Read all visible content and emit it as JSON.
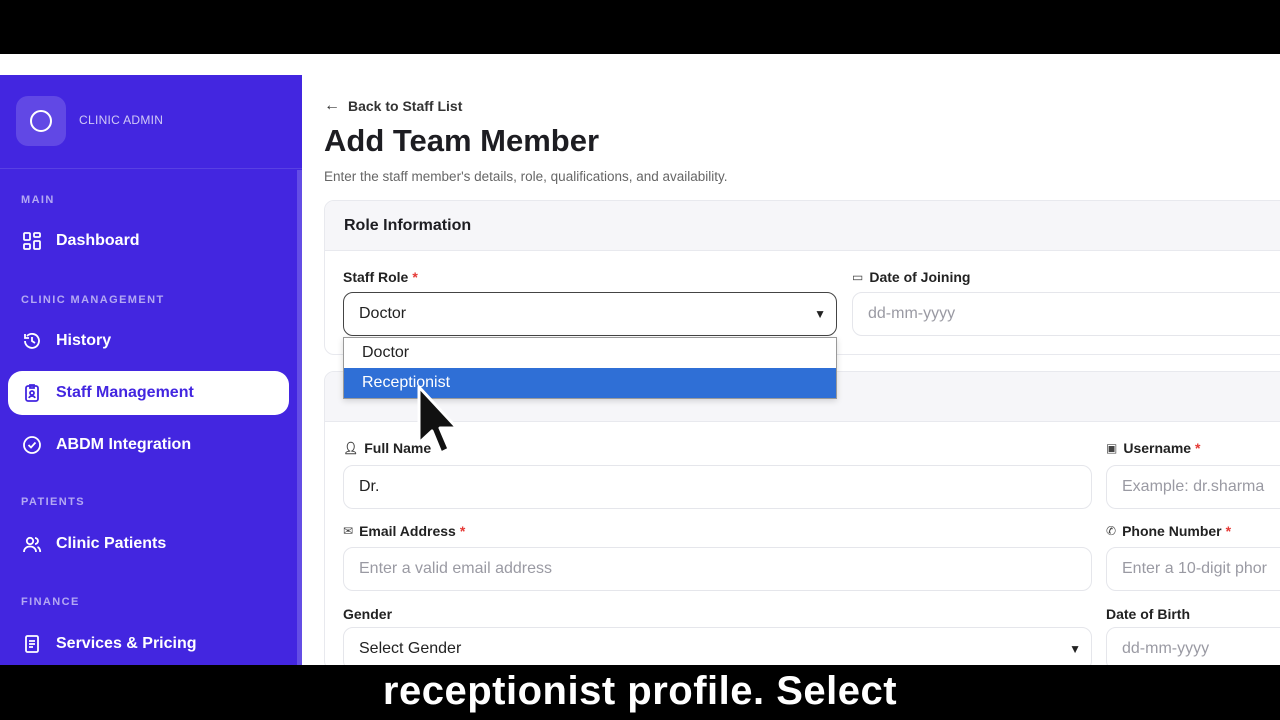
{
  "sidebar": {
    "brand": "CLINIC ADMIN",
    "sections": [
      {
        "label": "MAIN"
      },
      {
        "label": "CLINIC MANAGEMENT"
      },
      {
        "label": "PATIENTS"
      },
      {
        "label": "FINANCE"
      }
    ],
    "items": [
      {
        "label": "Dashboard",
        "icon": "dashboard-grid-icon"
      },
      {
        "label": "History",
        "icon": "history-icon"
      },
      {
        "label": "Staff Management",
        "icon": "id-badge-icon",
        "active": true
      },
      {
        "label": "ABDM Integration",
        "icon": "check-circle-icon"
      },
      {
        "label": "Clinic Patients",
        "icon": "users-icon"
      },
      {
        "label": "Services & Pricing",
        "icon": "document-list-icon"
      }
    ],
    "accent_color": "#4326e0"
  },
  "main": {
    "back_link": "Back to Staff List",
    "title": "Add Team Member",
    "subtitle": "Enter the staff member's details, role, qualifications, and availability.",
    "role_card": {
      "header": "Role Information",
      "staff_role_label": "Staff Role",
      "staff_role_value": "Doctor",
      "date_of_joining_label": "Date of Joining",
      "date_of_joining_placeholder": "dd-mm-yyyy"
    },
    "dropdown": {
      "options": [
        "Doctor",
        "Receptionist"
      ],
      "highlighted": "Receptionist"
    },
    "basic_card": {
      "full_name_label": "Full Name",
      "full_name_value": "Dr.",
      "username_label": "Username",
      "username_placeholder": "Example: dr.sharma",
      "email_label": "Email Address",
      "email_placeholder": "Enter a valid email address",
      "phone_label": "Phone Number",
      "phone_placeholder": "Enter a 10-digit phor",
      "gender_label": "Gender",
      "gender_value": "Select Gender",
      "dob_label": "Date of Birth",
      "dob_placeholder": "dd-mm-yyyy"
    },
    "required_mark": "*"
  },
  "caption": "receptionist profile. Select"
}
